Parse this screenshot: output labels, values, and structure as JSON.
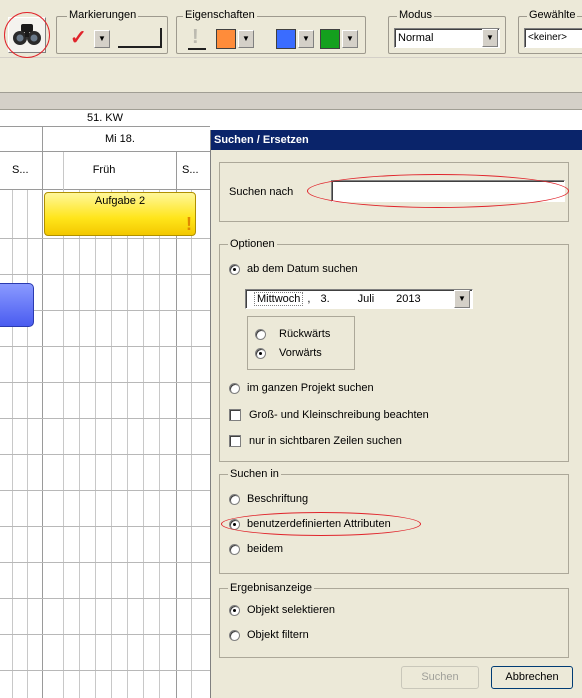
{
  "toolbar": {
    "groups": {
      "markings": "Markierungen",
      "properties": "Eigenschaften",
      "mode": "Modus",
      "selected": "Gewählte"
    },
    "mode_value": "Normal",
    "selected_value": "<keiner>",
    "checkmark": "✓",
    "exclamation": "!",
    "dropdown_arrow": "▼",
    "colors": {
      "orange": "#ff8c3a",
      "blue": "#3a6cff",
      "green": "#14a01e",
      "highlight": "#e0242b"
    },
    "icons": [
      "binoculars-icon",
      "checkmark-icon",
      "exclamation-icon"
    ]
  },
  "calendar": {
    "week": "51. KW",
    "day": "Mi 18.",
    "shift_left": "S...",
    "shift_mid": "Früh",
    "shift_right": "S...",
    "task": "Aufgabe 2",
    "task_flag": "!"
  },
  "dialog": {
    "title": "Suchen / Ersetzen",
    "search_label": "Suchen nach",
    "search_value": "",
    "options": {
      "legend": "Optionen",
      "from_date": "ab dem Datum suchen",
      "date": {
        "weekday": "Mittwoch",
        "sep": ",",
        "day": "3.",
        "month": "Juli",
        "year": "2013"
      },
      "backward": "Rückwärts",
      "forward": "Vorwärts",
      "whole_project": "im ganzen Projekt suchen",
      "match_case": "Groß- und Kleinschreibung beachten",
      "visible_rows": "nur in sichtbaren Zeilen suchen"
    },
    "search_in": {
      "legend": "Suchen in",
      "caption": "Beschriftung",
      "custom_attributes": "benutzerdefinierten Attributen",
      "both": "beidem"
    },
    "result": {
      "legend": "Ergebnisanzeige",
      "select": "Objekt selektieren",
      "filter": "Objekt filtern"
    },
    "buttons": {
      "search": "Suchen",
      "cancel": "Abbrechen"
    }
  }
}
